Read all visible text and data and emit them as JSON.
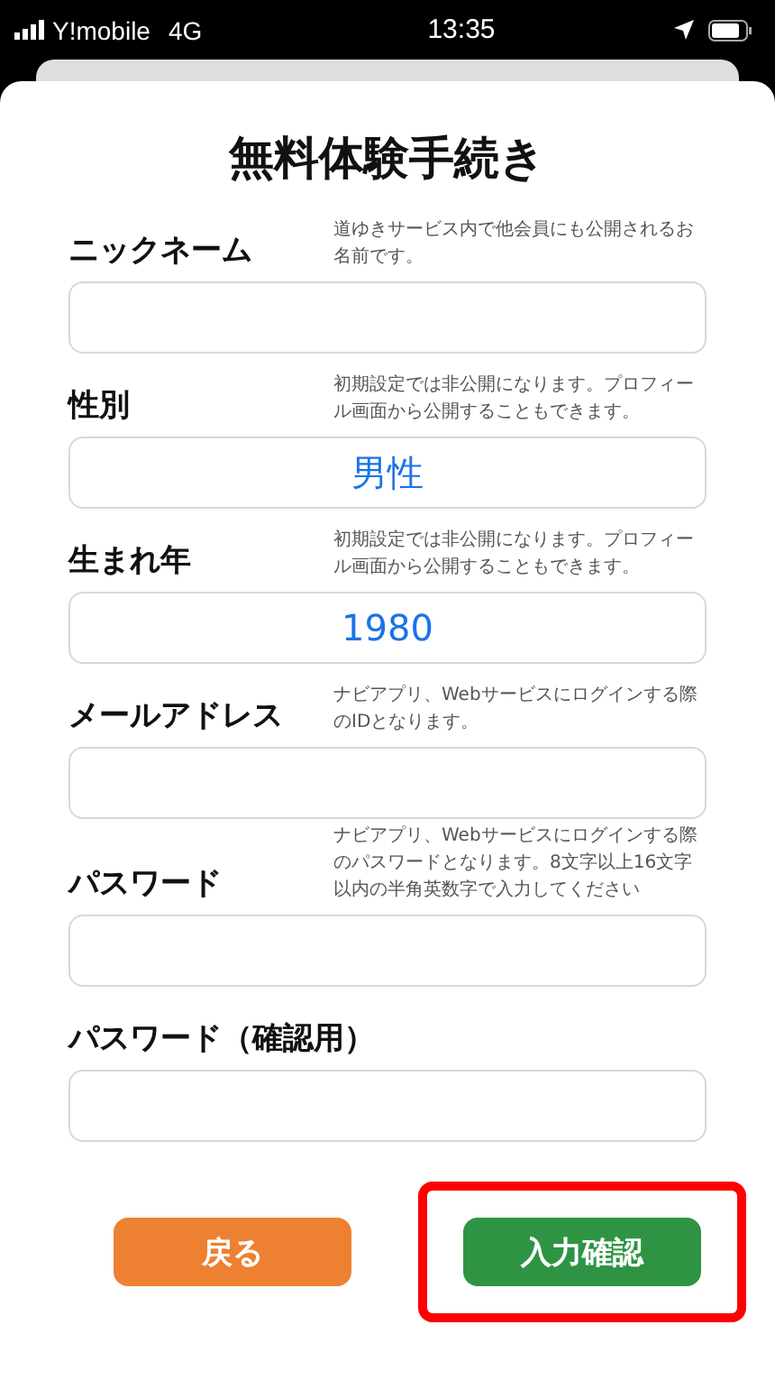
{
  "status_bar": {
    "carrier": "Y!mobile",
    "network": "4G",
    "time": "13:35"
  },
  "title": "無料体験手続き",
  "fields": [
    {
      "label": "ニックネーム",
      "hint": "道ゆきサービス内で他会員にも公開されるお名前です。"
    },
    {
      "label": "性別",
      "hint": "初期設定では非公開になります。プロフィール画面から公開することもできます。",
      "value": "男性"
    },
    {
      "label": "生まれ年",
      "hint": "初期設定では非公開になります。プロフィール画面から公開することもできます。",
      "value": "1980"
    },
    {
      "label": "メールアドレス",
      "hint": "ナビアプリ、Webサービスにログインする際のIDとなります。"
    },
    {
      "label": "パスワード",
      "hint": "ナビアプリ、Webサービスにログインする際のパスワードとなります。8文字以上16文字以内の半角英数字で入力してください"
    },
    {
      "label": "パスワード（確認用）"
    }
  ],
  "buttons": [
    {
      "label": "戻る",
      "kind": "back",
      "highlighted": false
    },
    {
      "label": "入力確認",
      "kind": "confirm",
      "highlighted": true
    }
  ]
}
